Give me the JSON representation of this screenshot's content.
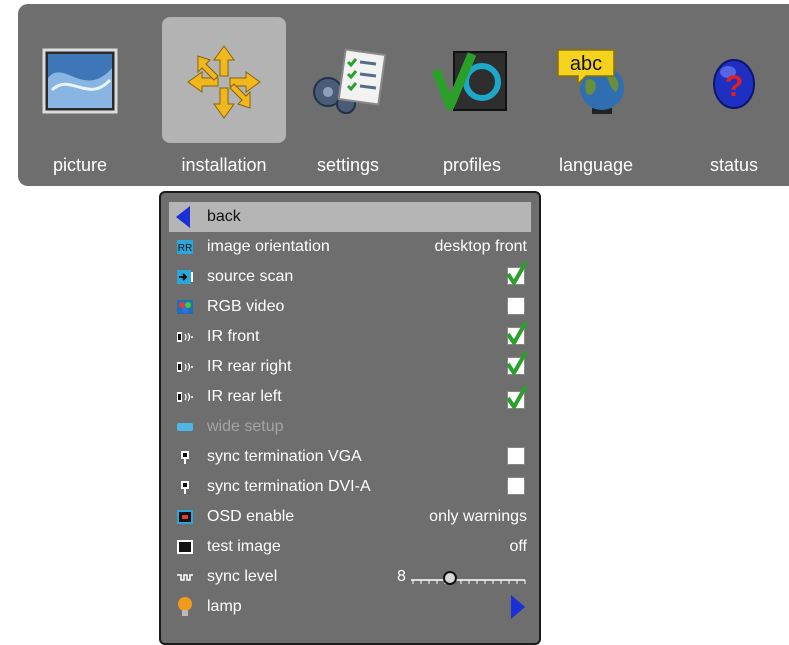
{
  "nav": {
    "items": [
      {
        "label": "picture",
        "icon": "picture-icon",
        "active": false
      },
      {
        "label": "installation",
        "icon": "installation-icon",
        "active": true
      },
      {
        "label": "settings",
        "icon": "settings-icon",
        "active": false
      },
      {
        "label": "profiles",
        "icon": "profiles-icon",
        "active": false
      },
      {
        "label": "language",
        "icon": "language-globe-icon",
        "active": false
      },
      {
        "label": "status",
        "icon": "status-help-icon",
        "active": false
      }
    ],
    "language_icon_text": "abc"
  },
  "menu": {
    "back_label": "back",
    "rows": [
      {
        "label": "image orientation",
        "icon": "orientation-icon",
        "value": "desktop front"
      },
      {
        "label": "source scan",
        "icon": "source-scan-icon",
        "checked": true
      },
      {
        "label": "RGB video",
        "icon": "rgb-video-icon",
        "checked": false
      },
      {
        "label": "IR front",
        "icon": "ir-sensor-icon",
        "checked": true
      },
      {
        "label": "IR rear right",
        "icon": "ir-sensor-icon",
        "checked": true
      },
      {
        "label": "IR rear left",
        "icon": "ir-sensor-icon",
        "checked": true
      },
      {
        "label": "wide setup",
        "icon": "wide-setup-icon",
        "disabled": true
      },
      {
        "label": "sync termination VGA",
        "icon": "connector-icon",
        "checked": false
      },
      {
        "label": "sync termination DVI-A",
        "icon": "connector-icon",
        "checked": false
      },
      {
        "label": "OSD enable",
        "icon": "osd-icon",
        "value": "only warnings"
      },
      {
        "label": "test image",
        "icon": "test-image-icon",
        "value": "off"
      },
      {
        "label": "sync level",
        "icon": "sync-level-icon",
        "slider_value": "8",
        "slider_fraction": 0.33
      },
      {
        "label": "lamp",
        "icon": "lamp-bulb-icon",
        "submenu": true
      }
    ]
  },
  "colors": {
    "panel_bg": "#6e6e6e",
    "selected_row": "#b5b5b5",
    "active_tile": "#b3b3b3",
    "check_green": "#2aa02a",
    "arrow_blue": "#1a2fd6",
    "disabled_text": "#a4a4a4"
  }
}
